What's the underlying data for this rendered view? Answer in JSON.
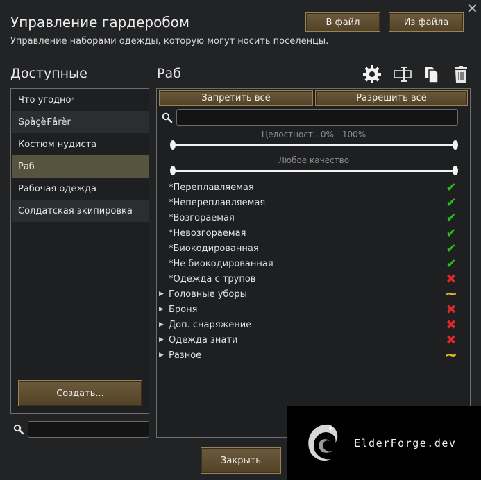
{
  "header": {
    "title": "Управление гардеробом",
    "subtitle": "Управление наборами одежды, которую могут носить поселенцы.",
    "to_file": "В файл",
    "from_file": "Из файла",
    "close_glyph": "✕"
  },
  "available": {
    "heading": "Доступные",
    "items": [
      {
        "label": "Что угодно",
        "mark": "*"
      },
      {
        "label": "ՏρàçèҒârèr",
        "mark": ""
      },
      {
        "label": "Костюм нудиста",
        "mark": ""
      },
      {
        "label": "Раб",
        "mark": ""
      },
      {
        "label": "Рабочая одежда",
        "mark": ""
      },
      {
        "label": "Солдатская экипировка",
        "mark": ""
      }
    ],
    "create_button": "Создать...",
    "search_placeholder": ""
  },
  "detail": {
    "heading": "Раб",
    "forbid_all": "Запретить всё",
    "allow_all": "Разрешить всё",
    "search_placeholder": "",
    "hp_slider_label": "Целостность 0% - 100%",
    "hp_range": [
      0,
      100
    ],
    "quality_slider_label": "Любое качество",
    "quality_range": [
      0,
      1
    ],
    "filters": [
      {
        "label": "*Переплавляемая",
        "expandable": false,
        "state": "check"
      },
      {
        "label": "*Непереплавляемая",
        "expandable": false,
        "state": "check"
      },
      {
        "label": "*Возгораемая",
        "expandable": false,
        "state": "check"
      },
      {
        "label": "*Невозгораемая",
        "expandable": false,
        "state": "check"
      },
      {
        "label": "*Биокодированная",
        "expandable": false,
        "state": "check"
      },
      {
        "label": "*Не биокодированная",
        "expandable": false,
        "state": "check"
      },
      {
        "label": "*Одежда с трупов",
        "expandable": false,
        "state": "cross"
      },
      {
        "label": "Головные уборы",
        "expandable": true,
        "state": "partial"
      },
      {
        "label": "Броня",
        "expandable": true,
        "state": "cross"
      },
      {
        "label": "Доп. снаряжение",
        "expandable": true,
        "state": "cross"
      },
      {
        "label": "Одежда знати",
        "expandable": true,
        "state": "cross"
      },
      {
        "label": "Разное",
        "expandable": true,
        "state": "partial"
      }
    ]
  },
  "footer": {
    "close_button": "Закрыть"
  },
  "watermark": {
    "text": "ElderForge.dev"
  },
  "colors": {
    "button_bg": "#6d5a3c",
    "selected_row": "#57533e",
    "check": "#22c21f",
    "cross": "#e02828",
    "partial": "#e2b52a"
  }
}
